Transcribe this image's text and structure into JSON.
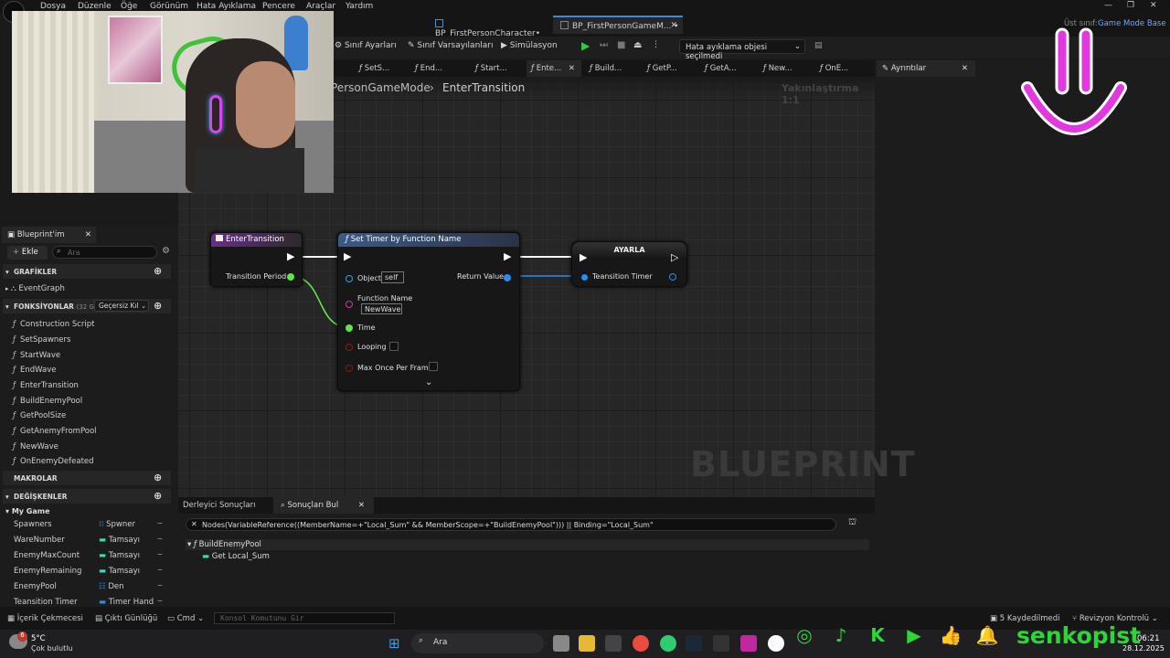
{
  "menu": [
    "Dosya",
    "Düzenle",
    "Öğe",
    "Görünüm",
    "Hata Ayıklama",
    "Pencere",
    "Araçlar",
    "Yardım"
  ],
  "doc_tabs": [
    {
      "label": "BP_FirstPersonCharacter•"
    },
    {
      "label": "BP_FirstPersonGameM... •"
    }
  ],
  "parent_class": {
    "label": "Üst sınıf:",
    "value": "Game Mode Base"
  },
  "toolbar": {
    "class_settings": "Sınıf Ayarları",
    "class_defaults": "Sınıf Varsayılanları",
    "simulation": "Simülasyon",
    "debug_object": "Hata ayıklama objesi seçilmedi"
  },
  "graph_tabs": [
    "SetS...",
    "End...",
    "Start...",
    "Ente...",
    "Build...",
    "GetP...",
    "GetA...",
    "New...",
    "OnE..."
  ],
  "details_tab": "Ayrıntılar",
  "breadcrumb": {
    "path": "PersonGameMode",
    "current": "EnterTransition"
  },
  "zoom": "Yakınlaştırma 1:1",
  "watermark": "BLUEPRINT",
  "my_blueprint": {
    "tab": "Blueprint'im",
    "add": "Ekle",
    "search_placeholder": "Ara",
    "graphs_header": "GRAFİKLER",
    "event_graph": "EventGraph",
    "functions_header": "FONKSİYONLAR",
    "functions_count": "(32 GEÇE",
    "override": "Geçersiz Kıl",
    "functions": [
      "Construction Script",
      "SetSpawners",
      "StartWave",
      "EndWave",
      "EnterTransition",
      "BuildEnemyPool",
      "GetPoolSize",
      "GetAnemyFromPool",
      "NewWave",
      "OnEnemyDefeated"
    ],
    "macros_header": "MAKROLAR",
    "variables_header": "DEĞİŞKENLER",
    "category": "My Game",
    "variables": [
      {
        "name": "Spawners",
        "type": "Spwner",
        "color": "#2d8cf0"
      },
      {
        "name": "WareNumber",
        "type": "Tamsayı",
        "color": "#2fe0b8"
      },
      {
        "name": "EnemyMaxCount",
        "type": "Tamsayı",
        "color": "#2fe0b8"
      },
      {
        "name": "EnemyRemaining",
        "type": "Tamsayı",
        "color": "#2fe0b8"
      },
      {
        "name": "EnemyPool",
        "type": "Den",
        "color": "#2d8cf0"
      },
      {
        "name": "Teansition Timer",
        "type": "Timer Hand",
        "color": "#2d8cf0"
      }
    ]
  },
  "nodes": {
    "enter": {
      "title": "EnterTransition",
      "pin": "Transition Period"
    },
    "timer": {
      "title": "Set Timer by Function Name",
      "object": "Object",
      "object_val": "self",
      "fn_name": "Function Name",
      "fn_val": "NewWave",
      "time": "Time",
      "looping": "Looping",
      "max_once": "Max Once Per Frame",
      "return": "Return Value"
    },
    "set": {
      "title": "AYARLA",
      "pin": "Teansition Timer"
    }
  },
  "bottom": {
    "tab1": "Derleyici Sonuçları",
    "tab2": "Sonuçları Bul",
    "query": "Nodes(VariableReference((MemberName=+\"Local_Sum\" && MemberScope=+\"BuildEnemyPool\"))) || Binding=\"Local_Sum\"",
    "result_fn": "BuildEnemyPool",
    "result_item": "Get Local_Sum"
  },
  "statusbar": {
    "content_drawer": "İçerik Çekmecesi",
    "output_log": "Çıktı Günlüğü",
    "cmd": "Cmd",
    "console_placeholder": "Konsol Komutunu Gir",
    "saved": "5 Kaydedilmedi",
    "revision": "Revizyon Kontrolü"
  },
  "taskbar": {
    "temp": "5°C",
    "weather": "Çok bulutlu",
    "badge": "6",
    "search": "Ara",
    "time": "06:21",
    "date": "28.12.2025"
  },
  "overlay": {
    "brand": "senkopist"
  },
  "colors": {
    "exec": "#ffffff",
    "float": "#62e34a",
    "object": "#3aa0e8",
    "struct": "#2d8cf0",
    "accent": "#3b87d8",
    "fn_header": "#3a4c72",
    "event_header": "#5c2a7a"
  }
}
